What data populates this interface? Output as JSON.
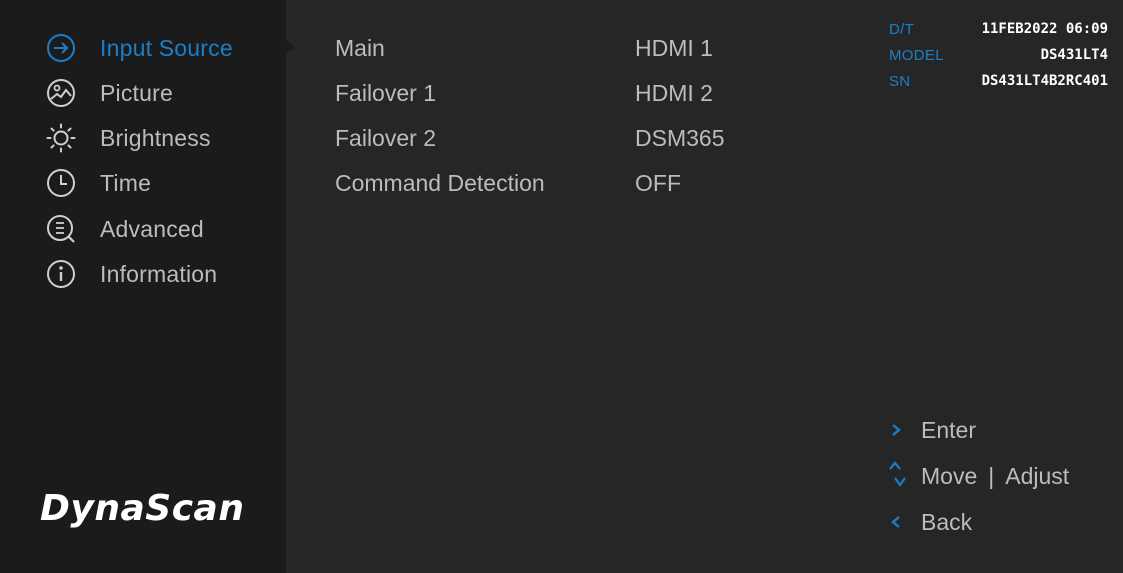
{
  "sidebar": {
    "items": [
      {
        "label": "Input Source",
        "icon": "input-source-icon",
        "active": true
      },
      {
        "label": "Picture",
        "icon": "picture-icon",
        "active": false
      },
      {
        "label": "Brightness",
        "icon": "brightness-icon",
        "active": false
      },
      {
        "label": "Time",
        "icon": "clock-icon",
        "active": false
      },
      {
        "label": "Advanced",
        "icon": "advanced-search-icon",
        "active": false
      },
      {
        "label": "Information",
        "icon": "info-icon",
        "active": false
      }
    ],
    "logo": "DynaScan"
  },
  "settings": [
    {
      "key": "Main",
      "value": "HDMI 1"
    },
    {
      "key": "Failover 1",
      "value": "HDMI 2"
    },
    {
      "key": "Failover 2",
      "value": "DSM365"
    },
    {
      "key": "Command Detection",
      "value": "OFF"
    }
  ],
  "device_info": {
    "dt_label": "D/T",
    "dt_value": "11FEB2022 06:09",
    "model_label": "MODEL",
    "model_value": "DS431LT4",
    "sn_label": "SN",
    "sn_value": "DS431LT4B2RC401"
  },
  "hints": {
    "enter": "Enter",
    "move": "Move",
    "divider": "|",
    "adjust": "Adjust",
    "back": "Back"
  },
  "colors": {
    "accent": "#1a7fc8",
    "sidebar_bg": "#1b1b1b",
    "main_bg": "#262626",
    "text": "#bcbcbc"
  }
}
